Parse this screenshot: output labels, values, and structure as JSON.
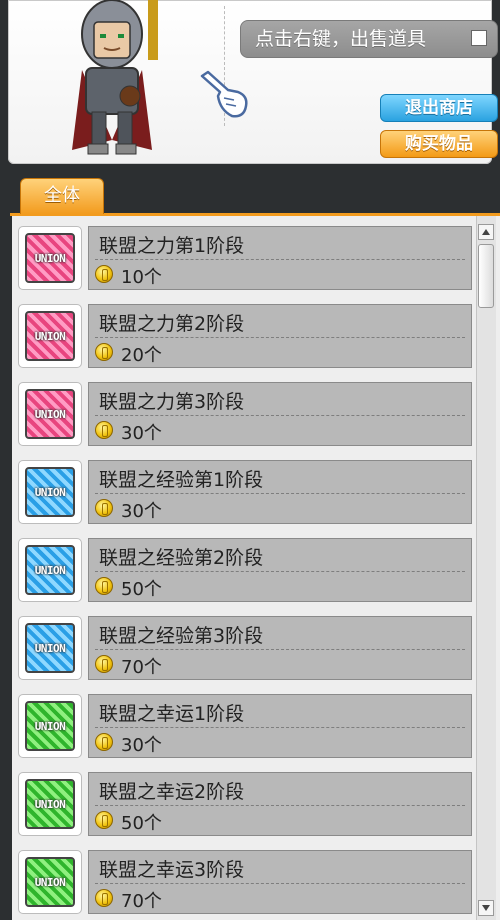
{
  "header": {
    "sell_tip": "点击右键，出售道具",
    "exit_button": "退出商店",
    "buy_button": "购买物品"
  },
  "tabs": [
    {
      "label": "全体",
      "active": true
    }
  ],
  "items": [
    {
      "name": "联盟之力第1阶段",
      "price": "10个",
      "icon": "union-pink-icon"
    },
    {
      "name": "联盟之力第2阶段",
      "price": "20个",
      "icon": "union-pink-icon"
    },
    {
      "name": "联盟之力第3阶段",
      "price": "30个",
      "icon": "union-pink-icon"
    },
    {
      "name": "联盟之经验第1阶段",
      "price": "30个",
      "icon": "union-blue-icon"
    },
    {
      "name": "联盟之经验第2阶段",
      "price": "50个",
      "icon": "union-blue-icon"
    },
    {
      "name": "联盟之经验第3阶段",
      "price": "70个",
      "icon": "union-blue-icon"
    },
    {
      "name": "联盟之幸运1阶段",
      "price": "30个",
      "icon": "union-green-icon"
    },
    {
      "name": "联盟之幸运2阶段",
      "price": "50个",
      "icon": "union-green-icon"
    },
    {
      "name": "联盟之幸运3阶段",
      "price": "70个",
      "icon": "union-green-icon"
    }
  ],
  "icon_label": "UNION",
  "colors": {
    "pink": "#e8457f",
    "blue": "#2a9fe6",
    "green": "#2fb52c",
    "accent_orange": "#f29b1e",
    "accent_blue": "#2aa2e0"
  }
}
